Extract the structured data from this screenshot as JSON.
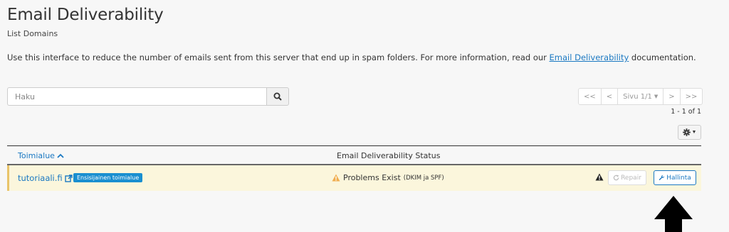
{
  "header": {
    "title": "Email Deliverability",
    "subtitle": "List Domains"
  },
  "intro": {
    "text_before": "Use this interface to reduce the number of emails sent from this server that end up in spam folders. For more information, read our ",
    "link_text": "Email Deliverability",
    "text_after": " documentation."
  },
  "search": {
    "placeholder": "Haku",
    "icon": "search-icon"
  },
  "pagination": {
    "first": "<<",
    "prev": "<",
    "page_label": "Sivu 1/1",
    "next": ">",
    "last": ">>",
    "range": "1 - 1 of 1"
  },
  "settings": {
    "icon": "gear-icon"
  },
  "table": {
    "columns": {
      "domain": "Toimialue",
      "status": "Email Deliverability Status"
    },
    "rows": [
      {
        "domain": "tutoriaali.fi",
        "badge": "Ensisijainen toimialue",
        "status": "Problems Exist",
        "status_detail": "(DKIM ja SPF)",
        "repair_label": "Repair",
        "manage_label": "Hallinta"
      }
    ]
  },
  "colors": {
    "link": "#1a78c2",
    "row_highlight": "#fbf6dc",
    "warning": "#f0ad4e",
    "badge": "#1a8fd0"
  }
}
